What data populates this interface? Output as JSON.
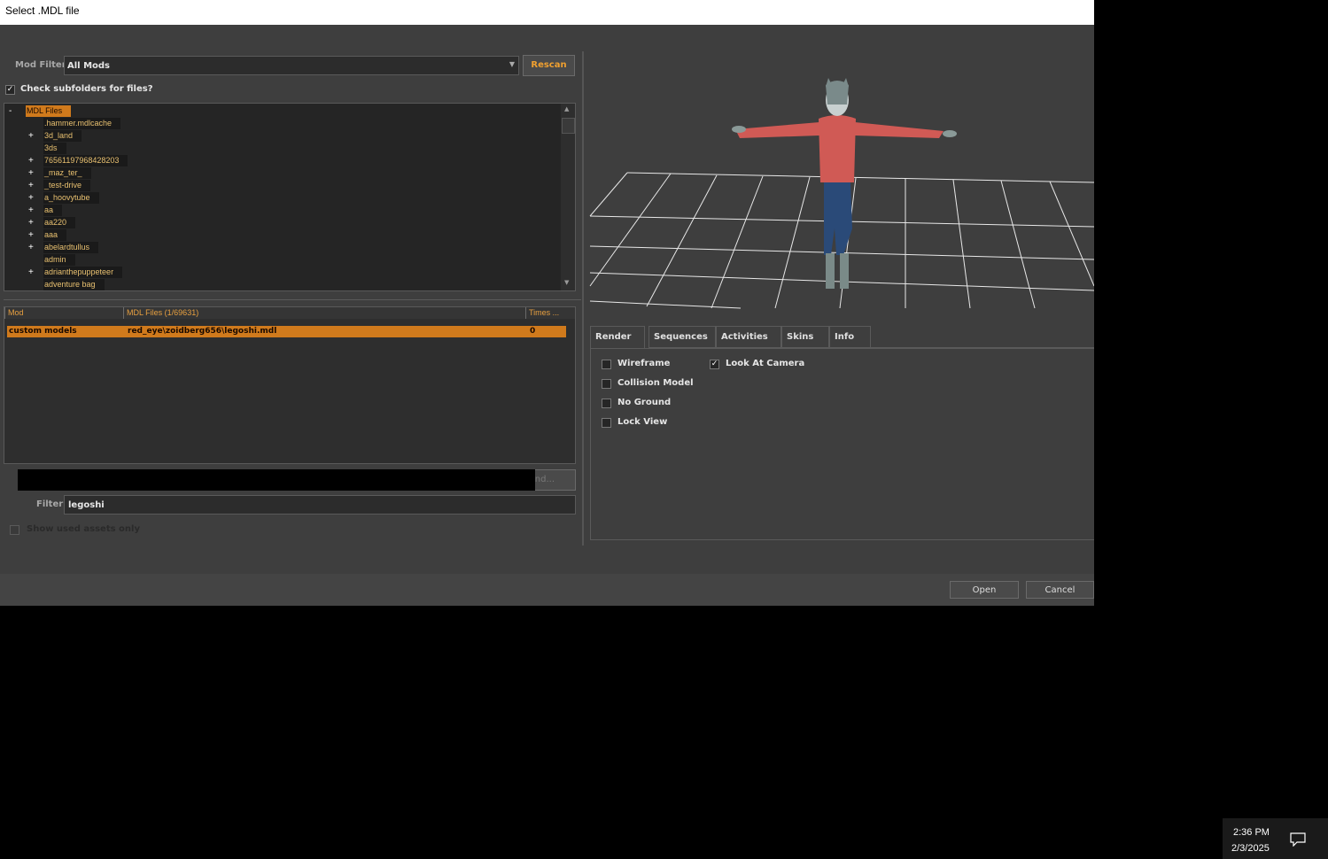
{
  "window": {
    "title": "Select .MDL file"
  },
  "mod_filter": {
    "label": "Mod Filter",
    "value": "All Mods",
    "rescan_label": "Rescan"
  },
  "subfolders": {
    "label": "Check subfolders for files?",
    "checked": true,
    "check_glyph": "✓"
  },
  "tree": {
    "root": {
      "label": "MDL Files",
      "toggle": "-"
    },
    "items": [
      {
        "label": ".hammer.mdlcache",
        "toggle": ""
      },
      {
        "label": "3d_land",
        "toggle": "+"
      },
      {
        "label": "3ds",
        "toggle": ""
      },
      {
        "label": "76561197968428203",
        "toggle": "+"
      },
      {
        "label": "_maz_ter_",
        "toggle": "+"
      },
      {
        "label": "_test-drive",
        "toggle": "+"
      },
      {
        "label": "a_hoovytube",
        "toggle": "+"
      },
      {
        "label": "aa",
        "toggle": "+"
      },
      {
        "label": "aa220",
        "toggle": "+"
      },
      {
        "label": "aaa",
        "toggle": "+"
      },
      {
        "label": "abelardtullus",
        "toggle": "+"
      },
      {
        "label": "admin",
        "toggle": ""
      },
      {
        "label": "adrianthepuppeteer",
        "toggle": "+"
      },
      {
        "label": "adventure bag",
        "toggle": ""
      }
    ]
  },
  "results": {
    "columns": [
      "Mod",
      "MDL Files (1/69631)",
      "Times ..."
    ],
    "rows": [
      {
        "mod": "custom models",
        "file": "red_eye\\zoidberg656\\legoshi.mdl",
        "times": "0"
      }
    ]
  },
  "find_button": "ind...",
  "filter": {
    "label": "Filter",
    "value": "legoshi"
  },
  "used_assets": {
    "label": "Show used assets only",
    "checked": false
  },
  "tabs": [
    "Render",
    "Sequences",
    "Activities",
    "Skins",
    "Info"
  ],
  "render_options": [
    {
      "label": "Wireframe",
      "checked": false
    },
    {
      "label": "Collision Model",
      "checked": false
    },
    {
      "label": "No Ground",
      "checked": false
    },
    {
      "label": "Lock View",
      "checked": false
    },
    {
      "label": "Look At Camera",
      "checked": true
    }
  ],
  "buttons": {
    "open": "Open",
    "cancel": "Cancel"
  },
  "taskbar": {
    "time": "2:36 PM",
    "date": "2/3/2025"
  },
  "colors": {
    "accent": "#d07a1c",
    "tree_text": "#e8c070",
    "rescan_text": "#f0a030"
  }
}
